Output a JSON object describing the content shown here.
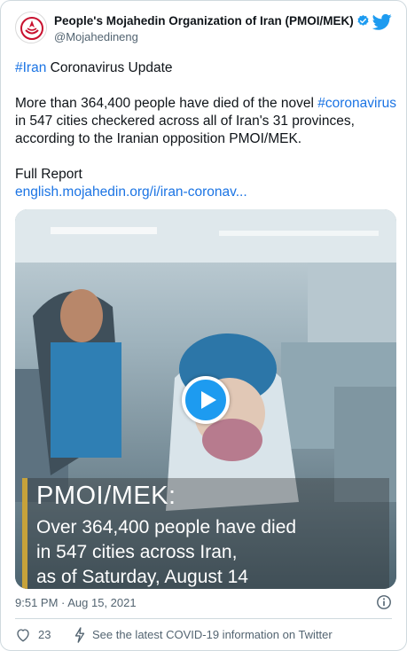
{
  "author": {
    "display_name": "People's Mojahedin Organization of Iran (PMOI/MEK)",
    "handle": "@Mojahedineng",
    "verified": true
  },
  "tweet": {
    "line1_hashtag": "#Iran",
    "line1_rest": " Coronavirus Update",
    "para2_start": "More than 364,400 people have died of the novel ",
    "para2_hashtag": "#coronavirus",
    "para2_rest": " in 547 cities checkered across all of Iran's 31 provinces, according to the Iranian opposition PMOI/MEK.",
    "full_report": "Full Report",
    "link_text": "english.mojahedin.org/i/iran-coronav..."
  },
  "media": {
    "caption_title": "PMOI/MEK:",
    "caption_lines": [
      "Over 364,400 people have died",
      "in 547 cities across Iran,",
      "as of Saturday, August 14"
    ]
  },
  "timestamp": "9:51 PM · Aug 15, 2021",
  "footer": {
    "like_count": "23",
    "covid_info": "See the latest COVID-19 information on Twitter"
  },
  "colors": {
    "link": "#1b74e4",
    "twitter_blue": "#1d9bf0",
    "caption_bar": "#c7a23a"
  }
}
